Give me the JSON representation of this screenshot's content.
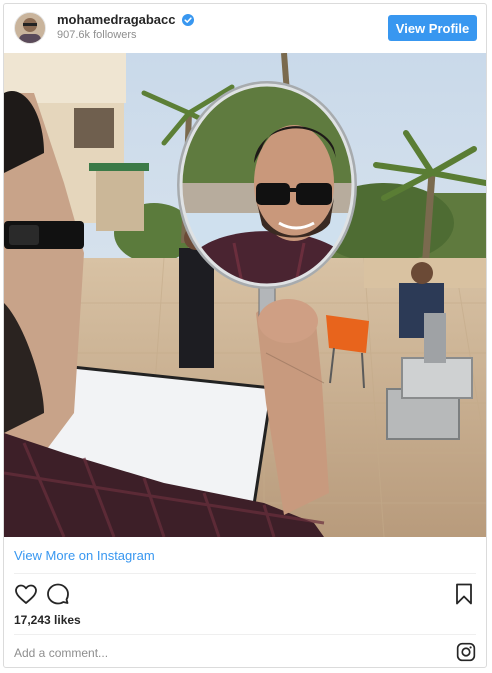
{
  "header": {
    "username": "mohamedragabacc",
    "followers": "907.6k followers",
    "view_profile_label": "View Profile",
    "verified_icon": "verified-badge-icon"
  },
  "post": {
    "view_more_label": "View More on Instagram",
    "likes": "17,243 likes",
    "comment_placeholder": "Add a comment..."
  },
  "icons": {
    "like": "heart-icon",
    "comment": "comment-icon",
    "save": "bookmark-icon",
    "instagram": "instagram-logo-icon"
  },
  "colors": {
    "accent": "#3897f0",
    "text": "#262626",
    "muted": "#8e8e8e",
    "border": "#dbdbdb"
  }
}
